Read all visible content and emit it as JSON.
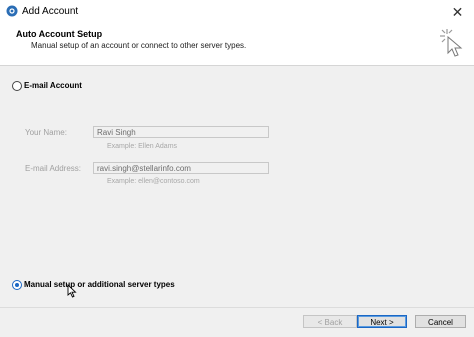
{
  "window": {
    "title": "Add Account",
    "close_glyph": "✕",
    "app_icon": "outlook-icon"
  },
  "header": {
    "title": "Auto Account Setup",
    "subtitle": "Manual setup of an account or connect to other server types.",
    "icon": "wizard-sparkle-icon"
  },
  "options": {
    "email_account_label": "E-mail Account",
    "email_account_selected": false,
    "manual_setup_label": "Manual setup or additional server types",
    "manual_setup_selected": true
  },
  "form": {
    "name_label": "Your Name:",
    "name_value": "Ravi Singh",
    "name_example": "Example: Ellen Adams",
    "email_label": "E-mail Address:",
    "email_value": "ravi.singh@stellarinfo.com",
    "email_example": "Example: ellen@contoso.com"
  },
  "buttons": {
    "back": "< Back",
    "next": "Next >",
    "cancel": "Cancel"
  },
  "colors": {
    "accent": "#1b67c4",
    "disabled_text": "#a0a0a0"
  }
}
